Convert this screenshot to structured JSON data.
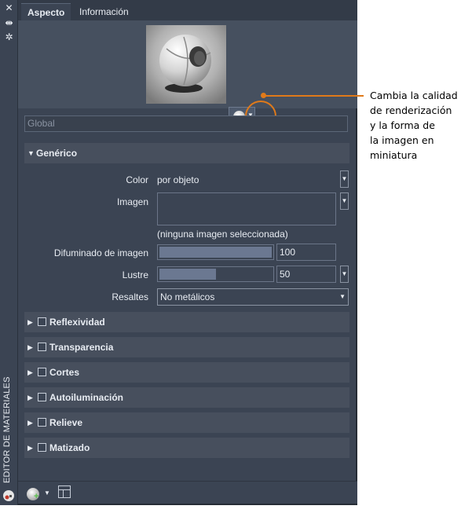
{
  "window": {
    "vertical_title": "EDITOR DE MATERIALES",
    "icons": [
      "close-icon",
      "pin-icon",
      "settings-icon"
    ]
  },
  "tabs": [
    {
      "label": "Aspecto",
      "active": true
    },
    {
      "label": "Información",
      "active": false
    }
  ],
  "preview": {
    "options_icon": "sphere-icon"
  },
  "name_field": {
    "placeholder": "Global"
  },
  "generic": {
    "title": "Genérico",
    "color_label": "Color",
    "color_value": "por objeto",
    "image_label": "Imagen",
    "image_none": "(ninguna imagen seleccionada)",
    "fade_label": "Difuminado de imagen",
    "fade_value": "100",
    "fade_fraction": 1.0,
    "gloss_label": "Lustre",
    "gloss_value": "50",
    "gloss_fraction": 0.5,
    "highlights_label": "Resaltes",
    "highlights_value": "No metálicos"
  },
  "sections": [
    {
      "label": "Reflexividad",
      "checked": false
    },
    {
      "label": "Transparencia",
      "checked": false
    },
    {
      "label": "Cortes",
      "checked": false
    },
    {
      "label": "Autoiluminación",
      "checked": false
    },
    {
      "label": "Relieve",
      "checked": false
    },
    {
      "label": "Matizado",
      "checked": false
    }
  ],
  "callout": {
    "line1": "Cambia la calidad",
    "line2": "de renderización",
    "line3": "y la forma de",
    "line4": "la imagen en",
    "line5": "miniatura",
    "color": "#e07a1a"
  }
}
